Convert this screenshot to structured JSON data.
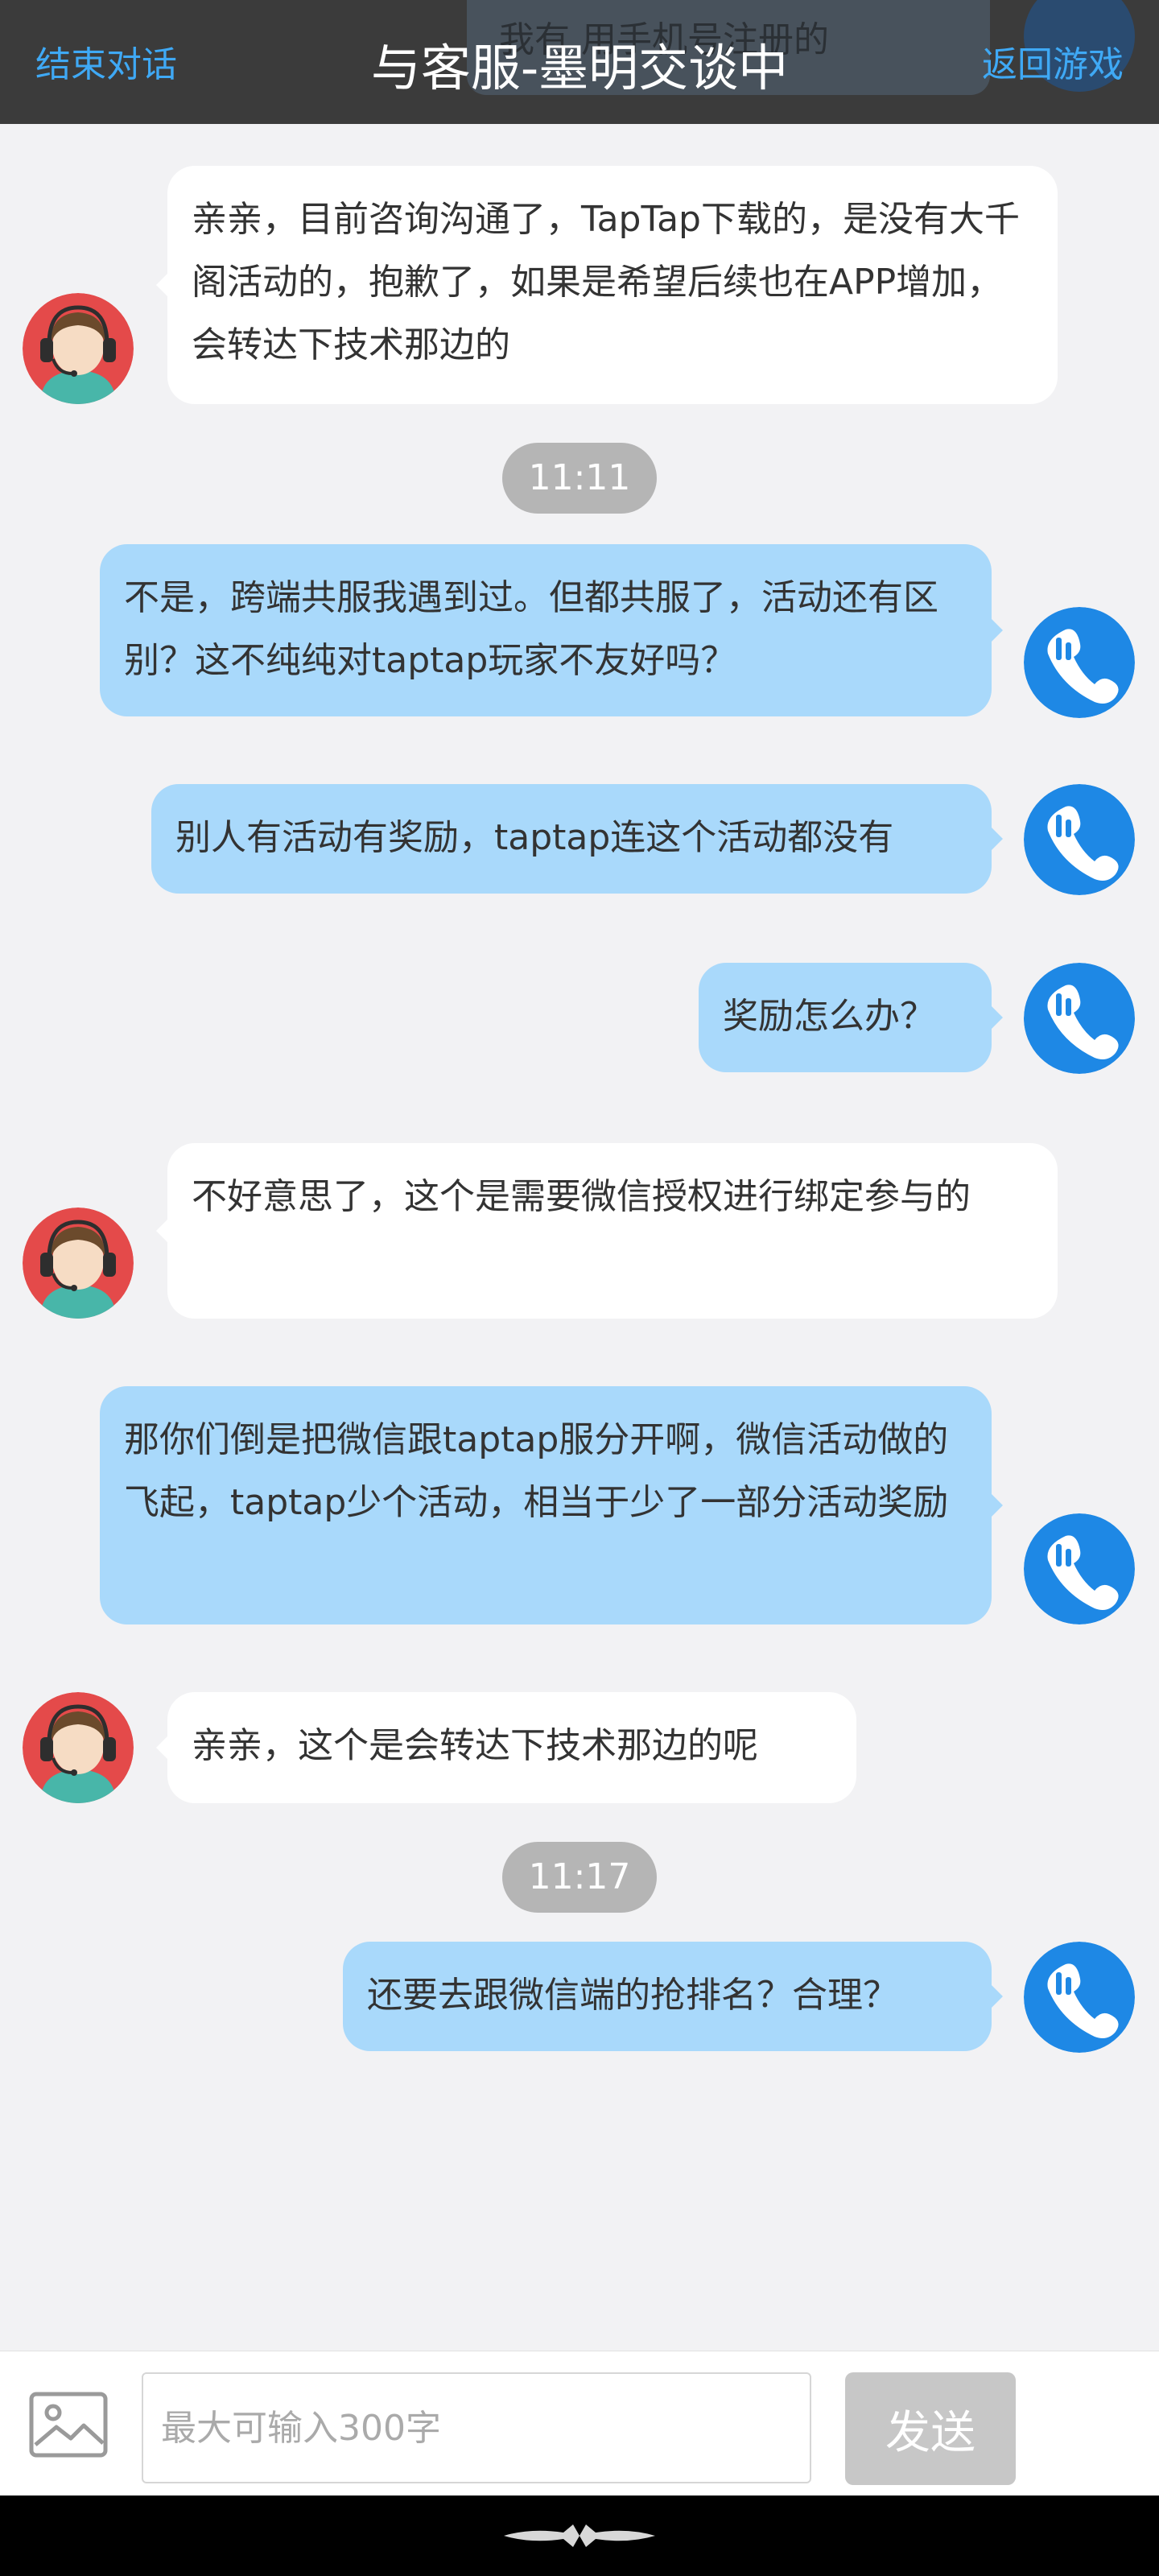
{
  "header": {
    "title": "与客服-墨明交谈中",
    "end_label": "结束对话",
    "back_label": "返回游戏",
    "overlay_text": "我有 用手机号注册的"
  },
  "messages": [
    {
      "sender": "agent",
      "text": "亲亲，目前咨询沟通了，TapTap下载的，是没有大千阁活动的，抱歉了，如果是希望后续也在APP增加，会转达下技术那边的"
    },
    {
      "sender": "time",
      "text": "11:11"
    },
    {
      "sender": "user",
      "text": "不是，跨端共服我遇到过。但都共服了，活动还有区别？这不纯纯对taptap玩家不友好吗？"
    },
    {
      "sender": "user",
      "text": "别人有活动有奖励，taptap连这个活动都没有"
    },
    {
      "sender": "user",
      "text": "奖励怎么办？"
    },
    {
      "sender": "agent",
      "text": "不好意思了，这个是需要微信授权进行绑定参与的"
    },
    {
      "sender": "user",
      "text": "那你们倒是把微信跟taptap服分开啊，微信活动做的飞起，taptap少个活动，相当于少了一部分活动奖励"
    },
    {
      "sender": "agent",
      "text": "亲亲，这个是会转达下技术那边的呢"
    },
    {
      "sender": "time",
      "text": "11:17"
    },
    {
      "sender": "user",
      "text": "还要去跟微信端的抢排名？合理？"
    }
  ],
  "composer": {
    "placeholder": "最大可输入300字",
    "send_label": "发送"
  },
  "colors": {
    "header_bg": "#3b3b3b",
    "link": "#3fa9f5",
    "user_bubble": "#a9d9fb",
    "agent_bubble": "#ffffff",
    "timestamp_bg": "#b5b5b5",
    "user_avatar": "#1e88e5"
  },
  "icons": {
    "agent_avatar": "customer-service-headset-avatar",
    "user_avatar": "phone-chat-app-icon",
    "image": "image-icon"
  }
}
